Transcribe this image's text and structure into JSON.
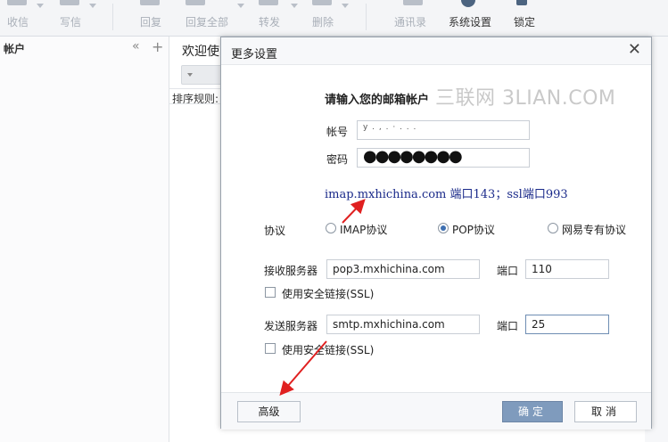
{
  "toolbar": {
    "items": [
      {
        "label": "收信",
        "icon": "inbox-download-icon"
      },
      {
        "label": "写信",
        "icon": "compose-icon"
      },
      {
        "label": "回复",
        "icon": "reply-icon"
      },
      {
        "label": "回复全部",
        "icon": "reply-all-icon"
      },
      {
        "label": "转发",
        "icon": "forward-icon"
      },
      {
        "label": "删除",
        "icon": "trash-icon"
      },
      {
        "label": "通讯录",
        "icon": "contacts-icon"
      },
      {
        "label": "系统设置",
        "icon": "gear-icon"
      },
      {
        "label": "锁定",
        "icon": "lock-icon"
      }
    ]
  },
  "sidebar": {
    "title": "帐户",
    "collapse_glyph": "«",
    "add_glyph": "+"
  },
  "background": {
    "tab_title": "欢迎使",
    "sort_label": "排序规则:"
  },
  "dialog": {
    "title": "更多设置",
    "close_glyph": "✕",
    "heading": "请输入您的邮箱帐户",
    "watermark": "三联网 3LIAN.COM",
    "account_label": "帐号",
    "account_value": "y  .  ,  .  ·  .  .  .",
    "password_label": "密码",
    "password_value": "●●●●●●●●",
    "note": "imap.mxhichina.com 端口143；ssl端口993",
    "protocol_label": "协议",
    "protocols": [
      {
        "label": "IMAP协议",
        "selected": false
      },
      {
        "label": "POP协议",
        "selected": true
      },
      {
        "label": "网易专有协议",
        "selected": false
      }
    ],
    "incoming": {
      "label": "接收服务器",
      "server": "pop3.mxhichina.com",
      "port_label": "端口",
      "port": "110",
      "ssl_label": "使用安全链接(SSL)",
      "ssl_checked": false
    },
    "outgoing": {
      "label": "发送服务器",
      "server": "smtp.mxhichina.com",
      "port_label": "端口",
      "port": "25",
      "ssl_label": "使用安全链接(SSL)",
      "ssl_checked": false
    },
    "buttons": {
      "advanced": "高级",
      "ok": "确定",
      "cancel": "取消"
    }
  },
  "colors": {
    "accent": "#7f9bbd",
    "annotation_arrow": "#e02020",
    "note_text": "#1a2a8a"
  }
}
